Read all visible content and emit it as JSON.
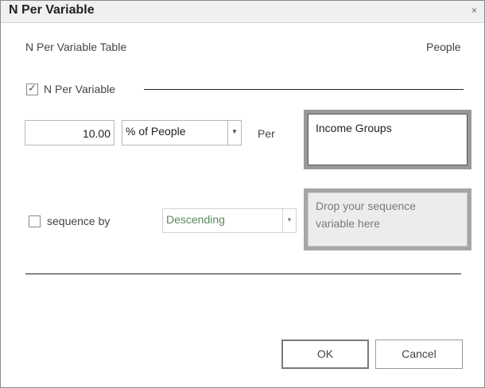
{
  "window": {
    "title": "N Per Variable",
    "close_glyph": "×"
  },
  "header": {
    "table_label": "N Per Variable Table",
    "population_label": "People"
  },
  "n_per_variable": {
    "checkbox_label": "N Per Variable",
    "checked": true,
    "check_glyph": "✓",
    "value": "10.00",
    "unit_selected": "% of People",
    "per_label": "Per",
    "variable_drop": "Income Groups"
  },
  "sequence": {
    "checkbox_label": "sequence by",
    "checked": false,
    "order_selected": "Descending",
    "drop_placeholder_line1": "Drop your sequence",
    "drop_placeholder_line2": "variable here"
  },
  "icons": {
    "dropdown": "caret-down-icon",
    "close": "close-icon",
    "check": "check-icon"
  },
  "footer": {
    "ok_label": "OK",
    "cancel_label": "Cancel"
  }
}
